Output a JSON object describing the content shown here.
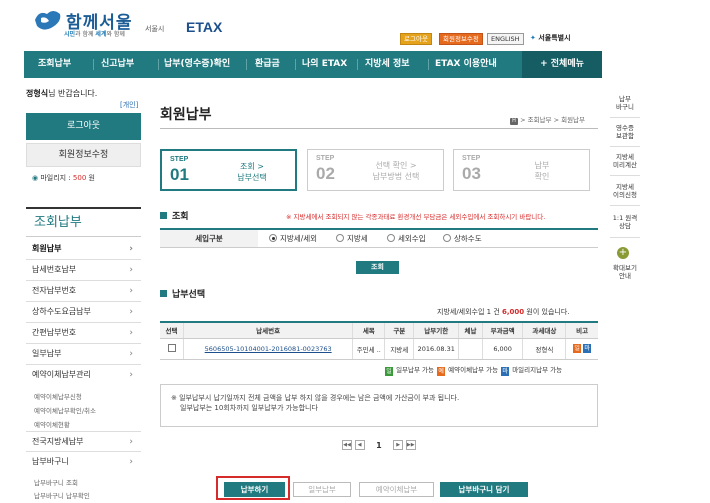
{
  "header": {
    "logo_text": "함께서울",
    "logo_sub_1": "시민",
    "logo_sub_2": "과 함께 ",
    "logo_sub_3": "세계",
    "logo_sub_4": "와 함께",
    "logo_city": "서울시",
    "logo_etax": "ETAX",
    "btn_logout": "로그아웃",
    "btn_member_edit": "회원정보수정",
    "btn_english": "ENGLISH",
    "seoul_city": "서울특별시"
  },
  "nav": {
    "items": [
      "조회납부",
      "신고납부",
      "납부(영수증)확인",
      "환급금",
      "나의 ETAX",
      "지방세 정보",
      "ETAX 이용안내"
    ],
    "all_menu": "+ 전체메뉴"
  },
  "sidebar": {
    "user_name": "정형식",
    "greeting_suffix": "님 반갑습니다.",
    "personal": "[개인]",
    "logout": "로그아웃",
    "member_edit": "회원정보수정",
    "mileage_label": "마일리지 : ",
    "mileage_value": "500",
    "mileage_unit": " 원",
    "section_title": "조회납부",
    "items": [
      "회원납부",
      "납세번호납부",
      "전자납부번호",
      "상하수도요금납부",
      "간편납부번호",
      "일부납부",
      "예약이체납부관리",
      "전국지방세납부",
      "납부바구니"
    ],
    "sub_reserve": [
      "예약이체납부신청",
      "예약이체납부확인/취소",
      "예약이체현황"
    ],
    "sub_basket": [
      "납부바구니 조회",
      "납부바구니 납부확인"
    ]
  },
  "main": {
    "title": "회원납부",
    "breadcrumb": "> 조회납부 > 회원납부",
    "steps": [
      {
        "label": "STEP",
        "num": "01",
        "line1": "조회 >",
        "line2": "납부선택"
      },
      {
        "label": "STEP",
        "num": "02",
        "line1": "선택 확인 >",
        "line2": "납부방법 선택"
      },
      {
        "label": "STEP",
        "num": "03",
        "line1": "납부",
        "line2": "확인"
      }
    ],
    "search_section": "조회",
    "notice": "※ 지방세에서 조회되지 않는 각종과태료 환경개선 부담금은 세외수입에서 조회하시기 바랍니다.",
    "filter_label": "세입구분",
    "radios": [
      "지방세/세외",
      "지방세",
      "세외수입",
      "상하수도"
    ],
    "search_btn": "조회",
    "payment_section": "납부선택",
    "count_prefix": "지방세/세외수입 1 건 ",
    "count_amount": "6,000",
    "count_suffix": " 원이 있습니다.",
    "table": {
      "headers": [
        "선택",
        "납세번호",
        "세목",
        "구분",
        "납부기한",
        "체납",
        "부과금액",
        "과세대상",
        "비고"
      ],
      "rows": [
        {
          "tax_no": "5606505-10104001-2016081-0023763",
          "item": "주민세 ..",
          "type": "지방세",
          "due": "2016.08.31",
          "arrears": "",
          "amount": "6,000",
          "target": "정형식",
          "tag1": "일",
          "tag2": "마"
        }
      ]
    },
    "legend": {
      "t1": "일",
      "l1": " 일부납부 가능 ",
      "t2": "예",
      "l2": " 예약이체납부 가능 ",
      "t3": "마",
      "l3": " 마일리지납부 가능"
    },
    "info_line1": "※ 일부납부시 납기일까지 전체 금액을 납부 하지 않을 경우에는 남은 금액에 가산금이 부과 됩니다.",
    "info_line2": "일부납부는 10회차까지 일부납부가 가능합니다",
    "paging": {
      "first": "◀◀",
      "prev": "◀",
      "current": "1",
      "next": "▶",
      "last": "▶▶"
    },
    "buttons": [
      "납부하기",
      "일부납부",
      "예약이체납부",
      "납부바구니 담기"
    ]
  },
  "quick": {
    "items": [
      "납부\n바구니",
      "영수증\n보관함",
      "지방세\n미리계산",
      "지방세\n이의신청",
      "1:1 원격\n상담"
    ],
    "plus": "+",
    "enlarge": "확대보기\n안내"
  },
  "colors": {
    "teal": "#207a80",
    "dark_teal": "#155d63",
    "red": "#d62b2b",
    "orange": "#e56a1e",
    "green": "#3a9a3a",
    "blue": "#2b6fb6"
  }
}
